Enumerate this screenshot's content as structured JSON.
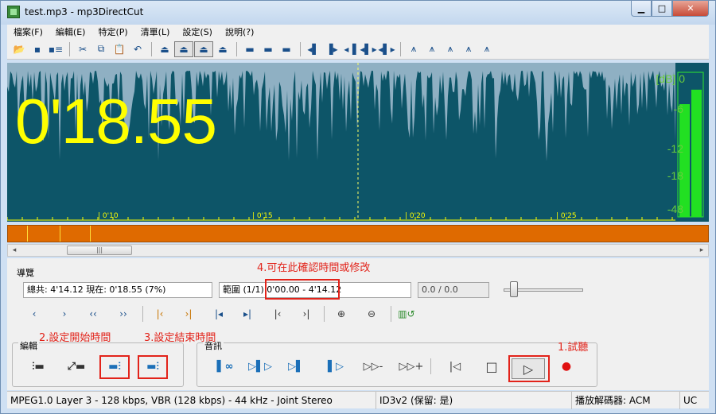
{
  "window": {
    "title": "test.mp3 - mp3DirectCut",
    "min_glyph": "▁",
    "max_glyph": "□",
    "close_glyph": "✕"
  },
  "menu": [
    "檔案(F)",
    "編輯(E)",
    "特定(P)",
    "清單(L)",
    "設定(S)",
    "說明(?)"
  ],
  "toolbar_glyphs": {
    "open": "📂",
    "save": "▪",
    "save_as": "▪≡",
    "cut": "✂",
    "copy": "⧉",
    "paste": "📋",
    "undo": "↶",
    "t1": "⏏",
    "t2": "⏏",
    "t3": "⏏",
    "t4": "⏏",
    "m1": "▬",
    "m2": "▬",
    "m3": "▬",
    "c1": "◂▌",
    "c2": "▐▸",
    "c3": "◂▐",
    "c4": "◂▌▸",
    "c5": "◂▌▸",
    "s1": "⩚",
    "s2": "⩚",
    "s3": "⩚",
    "s4": "⩚",
    "s5": "⩚"
  },
  "waveform": {
    "time": "0'18.55",
    "db_unit": "[dB]",
    "db_labels": [
      "0",
      "-6",
      "-12",
      "-18",
      "-48"
    ],
    "ruler": [
      "| 0'10",
      "| 0'15",
      "| 0'20",
      "| 0'25"
    ],
    "level_left": 0.78,
    "level_right": 0.88
  },
  "hscroll": {
    "thumb_grip": "|||",
    "left_arrow": "◂",
    "right_arrow": "▸"
  },
  "navigation": {
    "title": "導覽",
    "total_time": "總共: 4'14.12  現在: 0'18.55  (7%)",
    "range_label": "範圍 (1/1)",
    "range_value": "0'00.00 - 4'14.12",
    "gain": "0.0 / 0.0",
    "buttons": [
      "‹",
      "›",
      "‹‹",
      "››",
      "|‹",
      "›|",
      "|◂",
      "▸|",
      "|‹",
      "›|",
      "⊕",
      "⊖",
      "▥↺"
    ]
  },
  "edit": {
    "title": "編輯",
    "buttons": [
      "⫶▬",
      "⤢▬",
      "▬⫶",
      "▬⫶"
    ]
  },
  "audio": {
    "title": "音訊",
    "buttons": [
      "▌∞",
      "▷▌▷",
      "▷▌",
      "▌▷",
      "▷▷-",
      "▷▷+"
    ],
    "prev": "|◁",
    "stop": "□",
    "play": "▷",
    "record": "●"
  },
  "annotations": {
    "a1": "1.試聽",
    "a2": "2.設定開始時間",
    "a3": "3.設定結束時間",
    "a4": "4.可在此確認時間或修改"
  },
  "status": {
    "format": "MPEG1.0 Layer 3 - 128 kbps, VBR (128 kbps) - 44 kHz - Joint Stereo",
    "id3": "ID3v2 (保留: 是)",
    "decoder": "播放解碼器: ACM",
    "mode": "UC"
  }
}
